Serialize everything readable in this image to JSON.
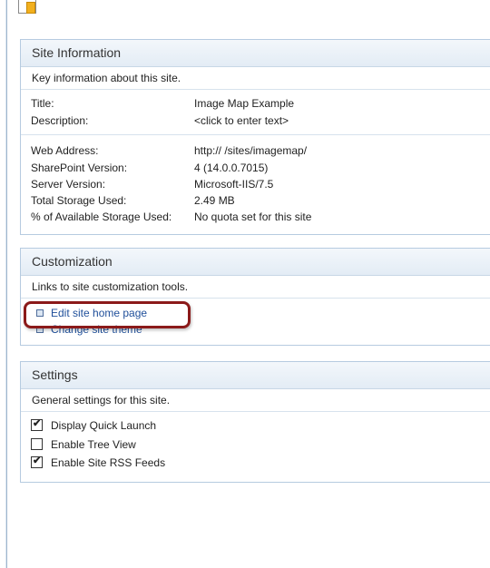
{
  "site_info": {
    "header": "Site Information",
    "description": "Key information about this site.",
    "rows": [
      {
        "label": "Title:",
        "value": "Image Map Example"
      },
      {
        "label": "Description:",
        "value": "<click to enter text>"
      },
      {
        "label": "Web Address:",
        "value": "http://                /sites/imagemap/"
      },
      {
        "label": "SharePoint Version:",
        "value": "4 (14.0.0.7015)"
      },
      {
        "label": "Server Version:",
        "value": "Microsoft-IIS/7.5"
      },
      {
        "label": "Total Storage Used:",
        "value": "2.49 MB"
      },
      {
        "label": "% of Available Storage Used:",
        "value": "No quota set for this site"
      }
    ]
  },
  "customization": {
    "header": "Customization",
    "description": "Links to site customization tools.",
    "links": [
      "Edit site home page",
      "Change site theme"
    ]
  },
  "settings": {
    "header": "Settings",
    "description": "General settings for this site.",
    "options": [
      {
        "label": "Display Quick Launch",
        "checked": true
      },
      {
        "label": "Enable Tree View",
        "checked": false
      },
      {
        "label": "Enable Site RSS Feeds",
        "checked": true
      }
    ]
  },
  "colors": {
    "link": "#1f4f9a",
    "highlight": "#8b1a1a",
    "header_bg": "#e3ecf5"
  },
  "icons": {
    "top": "site-home-icon"
  }
}
